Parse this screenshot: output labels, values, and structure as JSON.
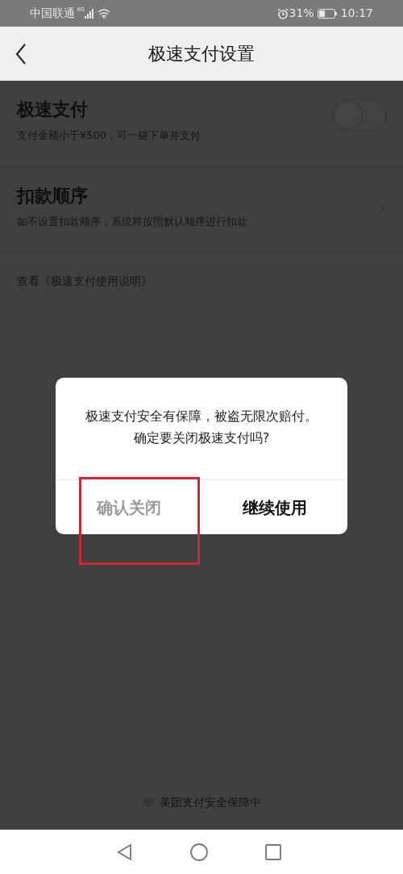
{
  "status_bar": {
    "carrier": "中国联通",
    "network": "4G",
    "battery": "31%",
    "time": "10:17"
  },
  "nav": {
    "title": "极速支付设置"
  },
  "settings": [
    {
      "kind": "toggle",
      "title": "极速支付",
      "subtitle": "支付金额小于¥500，可一键下单并支付",
      "on": false
    },
    {
      "kind": "link",
      "title": "扣款顺序",
      "subtitle": "如不设置扣款顺序，系统将按照默认顺序进行扣款"
    }
  ],
  "doc_link": "查看《极速支付使用说明》",
  "footer": "美团支付安全保障中",
  "dialog": {
    "message": "极速支付安全有保障，被盗无限次赔付。确定要关闭极速支付吗?",
    "buttons": [
      {
        "label": "确认关闭",
        "kind": "secondary",
        "highlighted": true
      },
      {
        "label": "继续使用",
        "kind": "primary",
        "highlighted": false
      }
    ]
  }
}
